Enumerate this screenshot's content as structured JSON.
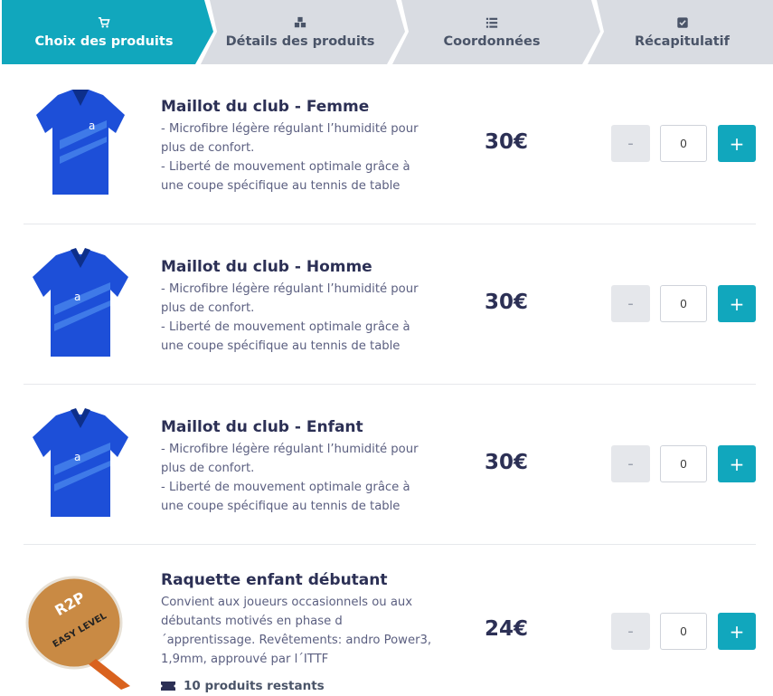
{
  "stepper": {
    "steps": [
      {
        "label": "Choix des produits",
        "icon": "cart-icon",
        "active": true
      },
      {
        "label": "Détails des produits",
        "icon": "boxes-icon",
        "active": false
      },
      {
        "label": "Coordonnées",
        "icon": "list-icon",
        "active": false
      },
      {
        "label": "Récapitulatif",
        "icon": "checkbox-icon",
        "active": false
      }
    ],
    "colors": {
      "active": "#11a7bd",
      "inactive": "#d9dce2"
    }
  },
  "products": [
    {
      "name": "Maillot du club - Femme",
      "description": "- Microfibre légère régulant l’humidité pour plus de confort.\n- Liberté de mouvement optimale grâce à une coupe spécifique au tennis de table",
      "price": "30€",
      "quantity": "0",
      "minus_label": "-",
      "plus_label": "+",
      "image": "jersey-women-image"
    },
    {
      "name": "Maillot du club - Homme",
      "description": "- Microfibre légère régulant l’humidité pour plus de confort.\n- Liberté de mouvement optimale grâce à une coupe spécifique au tennis de table",
      "price": "30€",
      "quantity": "0",
      "minus_label": "-",
      "plus_label": "+",
      "image": "jersey-men-image"
    },
    {
      "name": "Maillot du club - Enfant",
      "description": "- Microfibre légère régulant l’humidité pour plus de confort.\n- Liberté de mouvement optimale grâce à une coupe spécifique au tennis de table",
      "price": "30€",
      "quantity": "0",
      "minus_label": "-",
      "plus_label": "+",
      "image": "jersey-kids-image"
    },
    {
      "name": "Raquette enfant débutant",
      "description": "Convient aux joueurs occasionnels ou aux débutants motivés en phase d ´apprentissage. Revêtements: andro Power3, 1,9mm, approuvé par l´ITTF",
      "price": "24€",
      "quantity": "0",
      "minus_label": "-",
      "plus_label": "+",
      "image": "racket-image",
      "stock": "10 produits restants"
    }
  ]
}
